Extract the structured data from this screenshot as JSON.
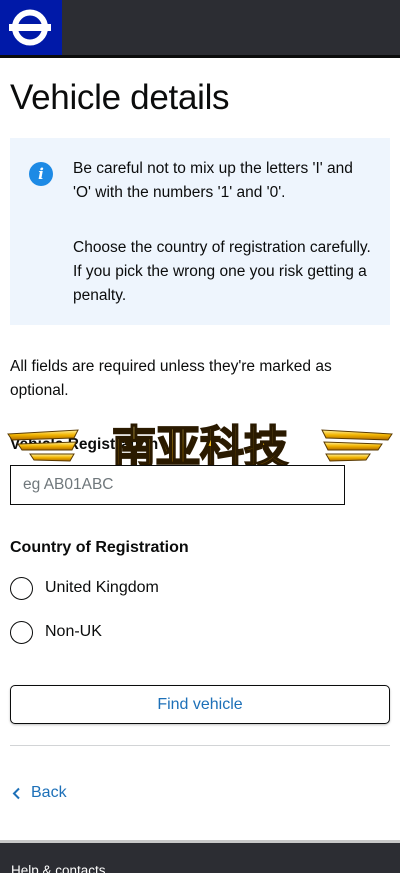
{
  "header": {
    "logo_icon": "roundel-icon",
    "colors": {
      "bar": "#2c2d33",
      "logo_bg": "#0019a8"
    }
  },
  "page": {
    "title": "Vehicle details"
  },
  "info_panel": {
    "icon": "info-icon",
    "paragraph_1": "Be careful not to mix up the letters 'I' and 'O' with the numbers '1' and '0'.",
    "paragraph_2": "Choose the country of registration carefully. If you pick the wrong one you risk getting a penalty.",
    "background": "#eef5fd"
  },
  "form": {
    "required_note": "All fields are required unless they're marked as optional.",
    "registration": {
      "label": "Vehicle Registration",
      "placeholder": "eg AB01ABC",
      "value": ""
    },
    "country": {
      "legend": "Country of Registration",
      "options": [
        {
          "label": "United Kingdom",
          "selected": false
        },
        {
          "label": "Non-UK",
          "selected": false
        }
      ]
    },
    "submit_label": "Find vehicle"
  },
  "watermark": {
    "text": "南亚科技"
  },
  "navigation": {
    "back_label": "Back"
  },
  "footer": {
    "link_label": "Help & contacts"
  },
  "colors": {
    "link": "#1d70b8",
    "info_icon": "#1d8ae5",
    "text": "#0b0c0c"
  }
}
